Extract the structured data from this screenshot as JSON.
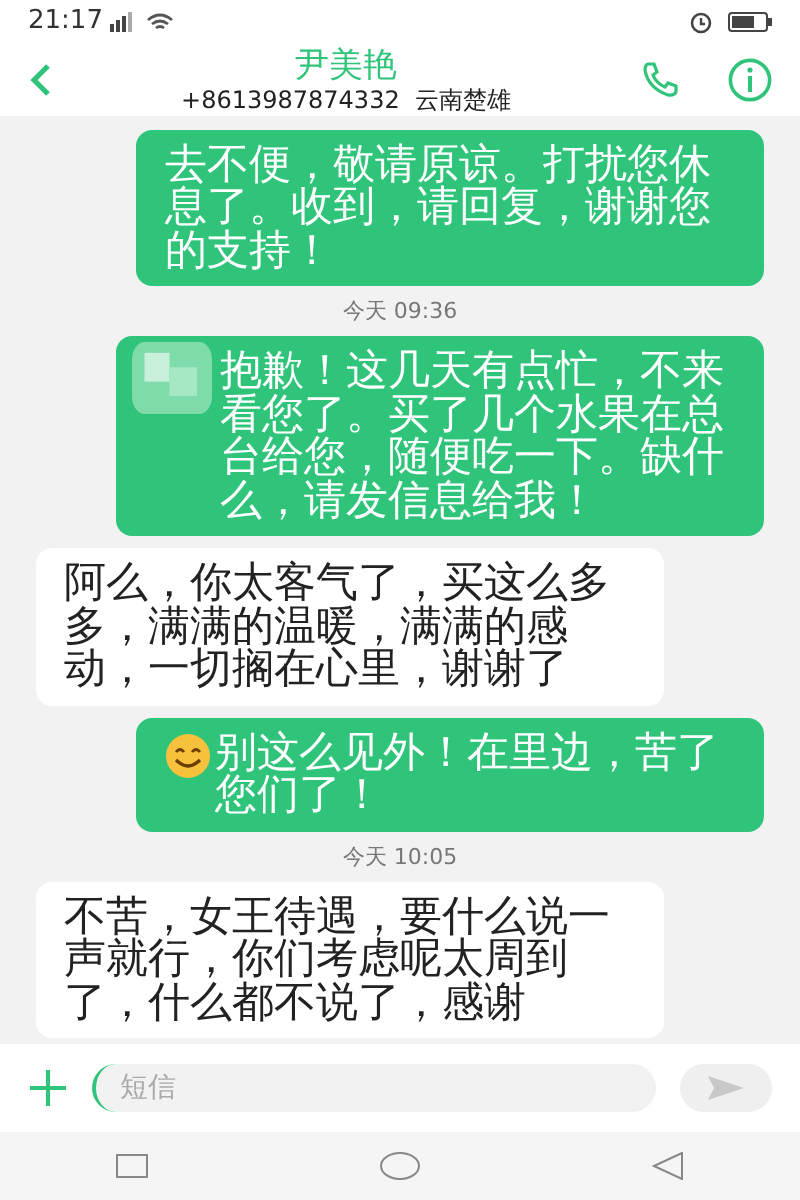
{
  "status_bar": {
    "time": "21:17"
  },
  "header": {
    "name": "尹美艳",
    "subtitle": "+8613987874332  云南楚雄"
  },
  "conversation": [
    {
      "kind": "sent",
      "text": "去不便，敬请原谅。打扰您休息了。收到，请回复，谢谢您的支持！"
    },
    {
      "kind": "timestamp",
      "text": "今天 09:36"
    },
    {
      "kind": "sent",
      "lead_icon": {
        "kind": "redaction"
      },
      "text": "抱歉！这几天有点忙，不来看您了。买了几个水果在总台给您，随便吃一下。缺什么，请发信息给我！"
    },
    {
      "kind": "received",
      "text": "阿么，你太客气了，买这么多多，满满的温暖，满满的感动，一切搁在心里，谢谢了"
    },
    {
      "kind": "sent",
      "lead_icon": {
        "kind": "smiley"
      },
      "text": "别这么见外！在里边，苦了您们了！"
    },
    {
      "kind": "timestamp",
      "text": "今天 10:05"
    },
    {
      "kind": "received",
      "text": "不苦，女王待遇，要什么说一声就行，你们考虑呢太周到了，什么都不说了，感谢"
    }
  ],
  "composer": {
    "placeholder": "短信"
  }
}
